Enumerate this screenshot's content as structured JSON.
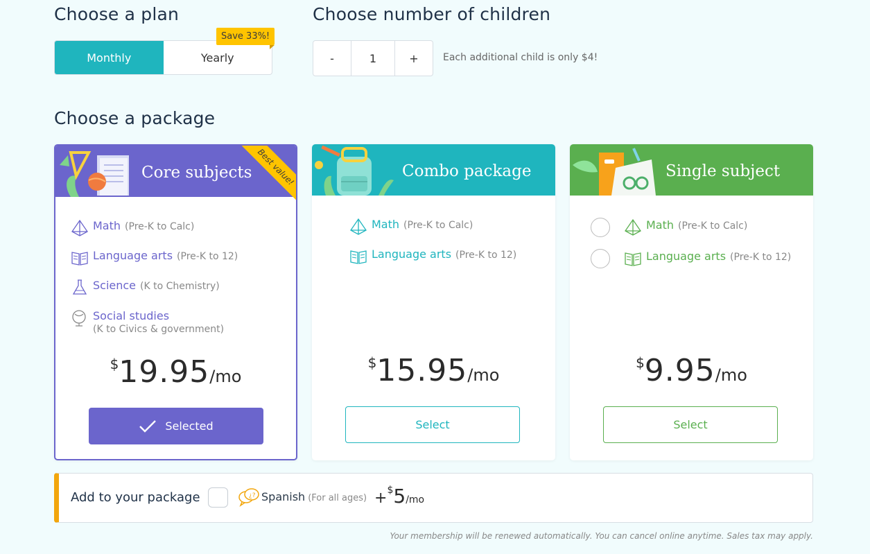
{
  "plan": {
    "heading": "Choose a plan",
    "monthly_label": "Monthly",
    "yearly_label": "Yearly",
    "save_badge": "Save 33%!"
  },
  "children": {
    "heading": "Choose number of children",
    "minus_label": "-",
    "plus_label": "+",
    "value": "1",
    "note": "Each additional child is only $4!"
  },
  "packages": {
    "heading": "Choose a package",
    "cards": [
      {
        "title": "Core subjects",
        "ribbon": "Best value!",
        "color": "#6b65cc",
        "subjects": [
          {
            "name": "Math",
            "range": "(Pre-K to Calc)",
            "icon": "pyramid-icon"
          },
          {
            "name": "Language arts",
            "range": "(Pre-K to 12)",
            "icon": "book-icon"
          },
          {
            "name": "Science",
            "range": "(K to Chemistry)",
            "icon": "flask-icon"
          },
          {
            "name": "Social studies",
            "range": "(K to Civics & government)",
            "icon": "globe-icon"
          }
        ],
        "currency": "$",
        "price": "19.95",
        "period": "/mo",
        "button_label": "Selected",
        "selected": true
      },
      {
        "title": "Combo package",
        "color": "#1fb5be",
        "subjects": [
          {
            "name": "Math",
            "range": "(Pre-K to Calc)",
            "icon": "pyramid-icon"
          },
          {
            "name": "Language arts",
            "range": "(Pre-K to 12)",
            "icon": "book-icon"
          }
        ],
        "currency": "$",
        "price": "15.95",
        "period": "/mo",
        "button_label": "Select",
        "selected": false
      },
      {
        "title": "Single subject",
        "color": "#5aaf4f",
        "subjects": [
          {
            "name": "Math",
            "range": "(Pre-K to Calc)",
            "icon": "pyramid-icon"
          },
          {
            "name": "Language arts",
            "range": "(Pre-K to 12)",
            "icon": "book-icon"
          }
        ],
        "currency": "$",
        "price": "9.95",
        "period": "/mo",
        "button_label": "Select",
        "selected": false
      }
    ]
  },
  "addon": {
    "label": "Add to your package",
    "name": "Spanish",
    "range": "(For all ages)",
    "plus": "+",
    "currency": "$",
    "price": "5",
    "period": "/mo",
    "accent": "#f2a60d"
  },
  "footnote": "Your membership will be renewed automatically. You can cancel online anytime. Sales tax may apply."
}
